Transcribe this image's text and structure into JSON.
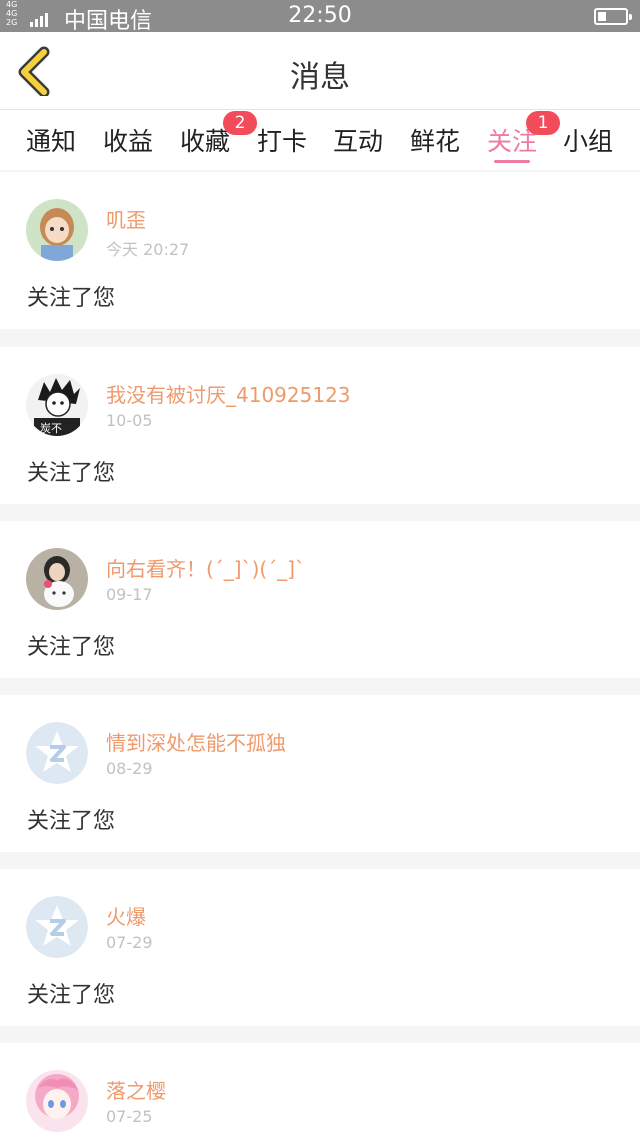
{
  "status_bar": {
    "network_top": "4G 4G",
    "network_bottom": "2G",
    "carrier": "中国电信",
    "time": "22:50"
  },
  "header": {
    "back_icon": "chevron-left-icon",
    "title": "消息"
  },
  "tabs": [
    {
      "label": "通知",
      "badge": ""
    },
    {
      "label": "收益",
      "badge": ""
    },
    {
      "label": "收藏",
      "badge": "2"
    },
    {
      "label": "打卡",
      "badge": ""
    },
    {
      "label": "互动",
      "badge": ""
    },
    {
      "label": "鲜花",
      "badge": ""
    },
    {
      "label": "关注",
      "badge": "1",
      "active": true
    },
    {
      "label": "小组",
      "badge": ""
    }
  ],
  "feed": [
    {
      "name": "叽歪",
      "time": "今天 20:27",
      "message": "关注了您"
    },
    {
      "name": "我没有被讨厌_410925123",
      "time": "10-05",
      "message": "关注了您",
      "avatar_caption": "炭不"
    },
    {
      "name": "向右看齐！(´_]`)(´_]`",
      "time": "09-17",
      "message": "关注了您"
    },
    {
      "name": "情到深处怎能不孤独",
      "time": "08-29",
      "message": "关注了您"
    },
    {
      "name": "火爆",
      "time": "07-29",
      "message": "关注了您"
    },
    {
      "name": "落之樱",
      "time": "07-25",
      "message": ""
    }
  ],
  "colors": {
    "accent": "#f07aa3",
    "username": "#ef9a6c",
    "badge": "#f24b5a",
    "back_icon": "#f5d23c"
  }
}
